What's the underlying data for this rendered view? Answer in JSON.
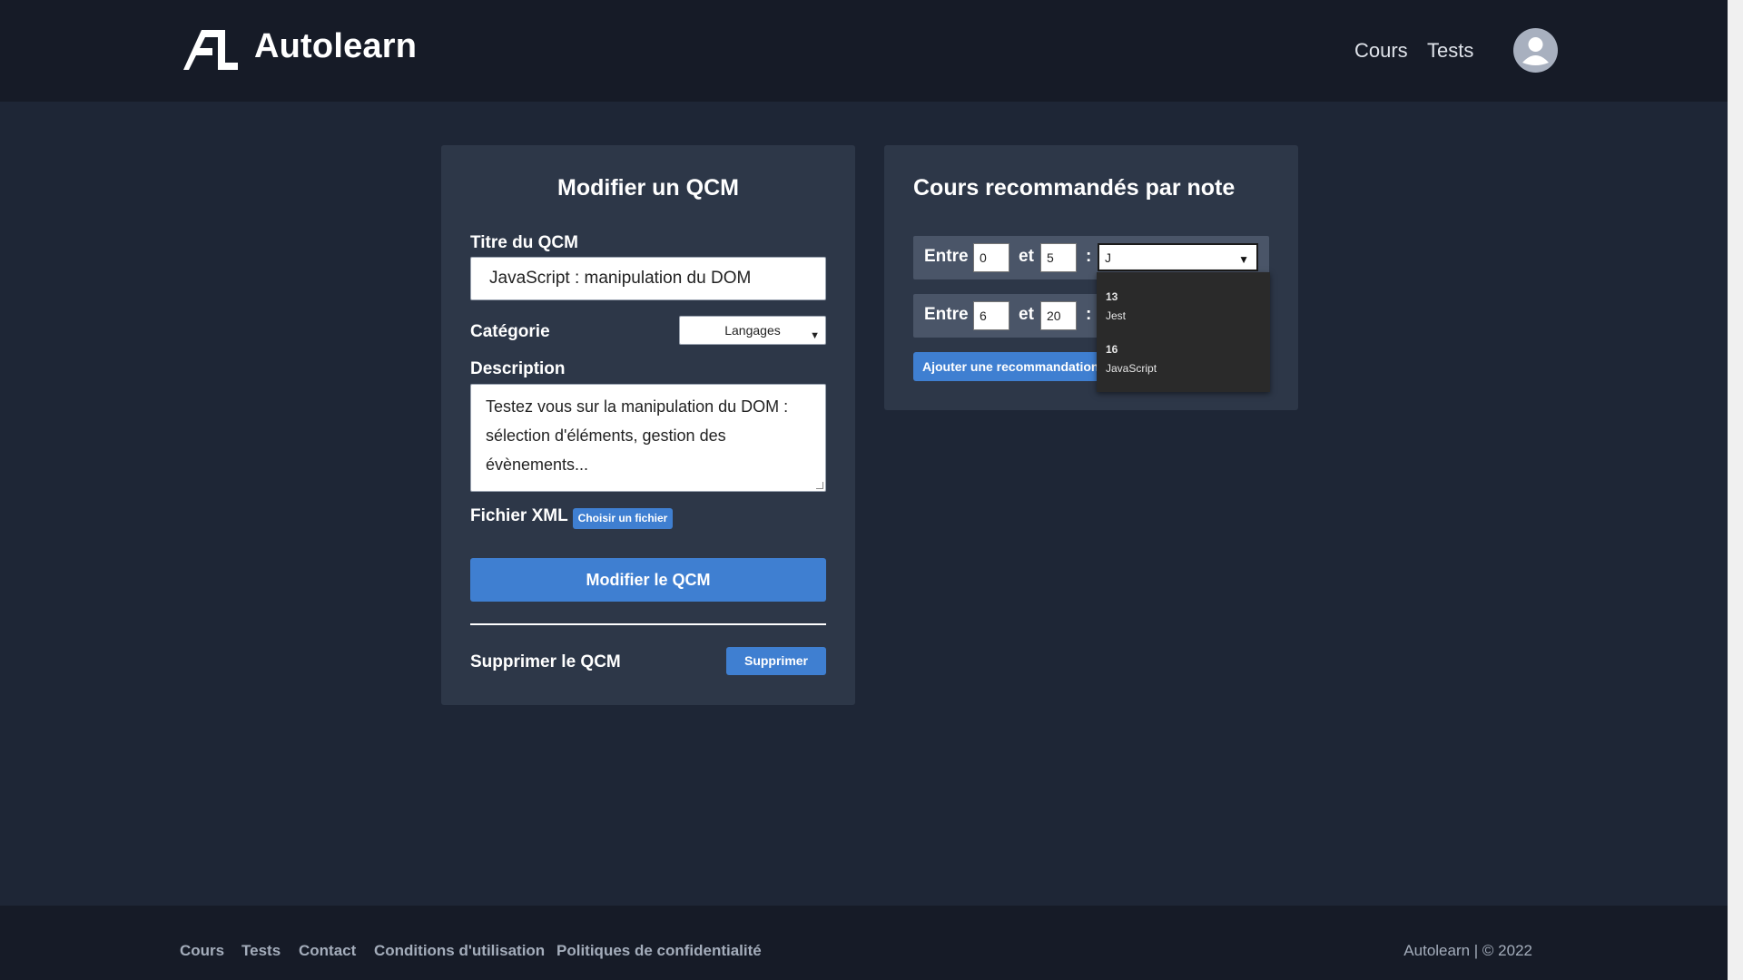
{
  "header": {
    "brand": "Autolearn",
    "nav": [
      "Cours",
      "Tests"
    ]
  },
  "left_card": {
    "title": "Modifier un QCM",
    "title_label": "Titre du QCM",
    "title_value": "JavaScript : manipulation du DOM",
    "category_label": "Catégorie",
    "category_value": "Langages",
    "description_label": "Description",
    "description_value": "Testez vous sur la manipulation du DOM : sélection d'éléments, gestion des évènements...",
    "xml_label": "Fichier XML",
    "file_button": "Choisir un fichier",
    "submit_button": "Modifier le QCM",
    "delete_label": "Supprimer le QCM",
    "delete_button": "Supprimer"
  },
  "right_card": {
    "title": "Cours recommandés par note",
    "rows": [
      {
        "entre": "Entre",
        "from": "0",
        "et": "et",
        "to": "5",
        "colon": ":"
      },
      {
        "entre": "Entre",
        "from": "6",
        "et": "et",
        "to": "20",
        "colon": ":"
      }
    ],
    "combo_value": "J",
    "add_button": "Ajouter une recommandation",
    "dropdown": [
      {
        "value": "13",
        "label": "Jest"
      },
      {
        "value": "16",
        "label": "JavaScript"
      }
    ]
  },
  "footer": {
    "links": [
      "Cours",
      "Tests",
      "Contact",
      "Conditions d'utilisation",
      "Politiques de confidentialité"
    ],
    "copyright": "Autolearn | © 2022"
  },
  "colors": {
    "background": "#1e2636",
    "header": "#161b27",
    "card": "#2d3748",
    "accent": "#3f7fd1"
  }
}
